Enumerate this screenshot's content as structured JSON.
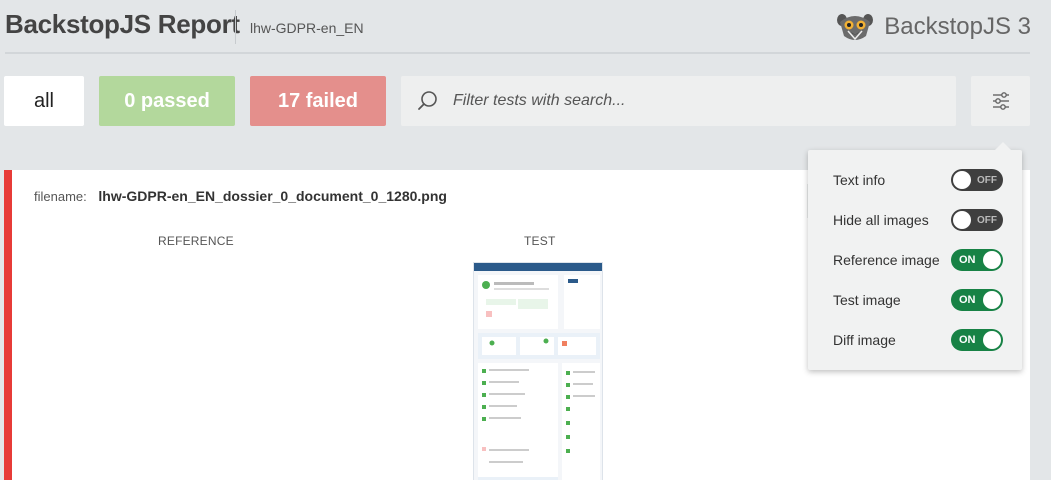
{
  "header": {
    "title": "BackstopJS Report",
    "project": "lhw-GDPR-en_EN",
    "brand": "BackstopJS 3"
  },
  "filters": {
    "all_label": "all",
    "passed_label": "0 passed",
    "failed_label": "17 failed",
    "search_placeholder": "Filter tests with search..."
  },
  "settings": {
    "options": [
      {
        "label": "Text info",
        "state": "OFF"
      },
      {
        "label": "Hide all images",
        "state": "OFF"
      },
      {
        "label": "Reference image",
        "state": "ON"
      },
      {
        "label": "Test image",
        "state": "ON"
      },
      {
        "label": "Diff image",
        "state": "ON"
      }
    ]
  },
  "test_card": {
    "filename_label": "filename:",
    "filename": "lhw-GDPR-en_EN_dossier_0_document_0_1280.png",
    "reference_label": "REFERENCE",
    "test_label": "TEST",
    "status_color": "#e73b37"
  },
  "colors": {
    "passed": "#b3d89c",
    "failed": "#e48f8c",
    "toggle_on": "#178245",
    "toggle_off": "#3f3f3f"
  },
  "icons": {
    "search": "search-icon",
    "settings": "sliders-icon",
    "brand": "lemur-logo-icon"
  }
}
